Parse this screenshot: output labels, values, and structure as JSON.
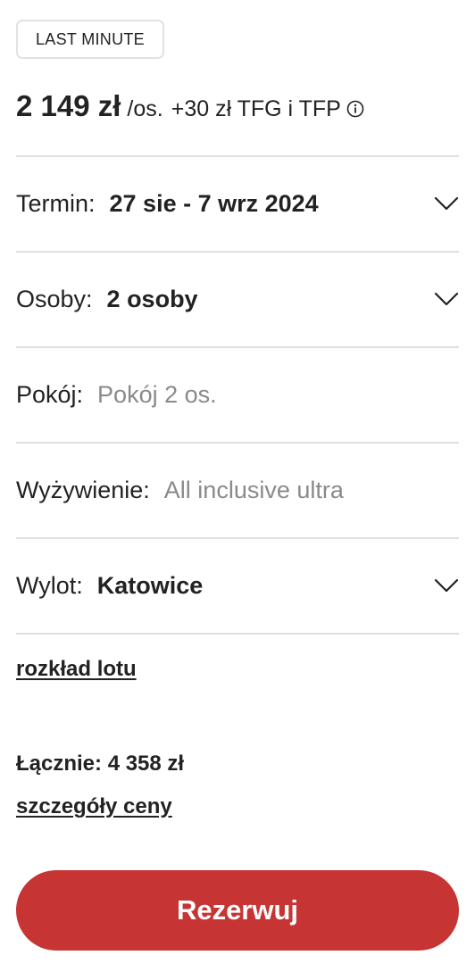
{
  "badge": {
    "label": "LAST MINUTE"
  },
  "price": {
    "amount": "2 149 zł",
    "per": "/os.",
    "extra": "+30 zł TFG i TFP",
    "info_icon": "info-circle-icon"
  },
  "rows": {
    "termin": {
      "label": "Termin:",
      "value": "27 sie - 7 wrz 2024",
      "icon": "chevron-down-icon"
    },
    "osoby": {
      "label": "Osoby:",
      "value": "2 osoby",
      "icon": "chevron-down-icon"
    },
    "pokoj": {
      "label": "Pokój:",
      "value": "Pokój 2 os."
    },
    "wyzywienie": {
      "label": "Wyżywienie:",
      "value": "All inclusive ultra"
    },
    "wylot": {
      "label": "Wylot:",
      "value": "Katowice",
      "icon": "chevron-down-icon"
    }
  },
  "links": {
    "flight_schedule": "rozkład lotu",
    "price_details": "szczegóły ceny"
  },
  "total": {
    "text": "Łącznie: 4 358 zł"
  },
  "reserve": {
    "label": "Rezerwuj"
  },
  "colors": {
    "accent": "#c63534",
    "muted_text": "#8a8a8a",
    "divider": "#e0e0e0"
  }
}
